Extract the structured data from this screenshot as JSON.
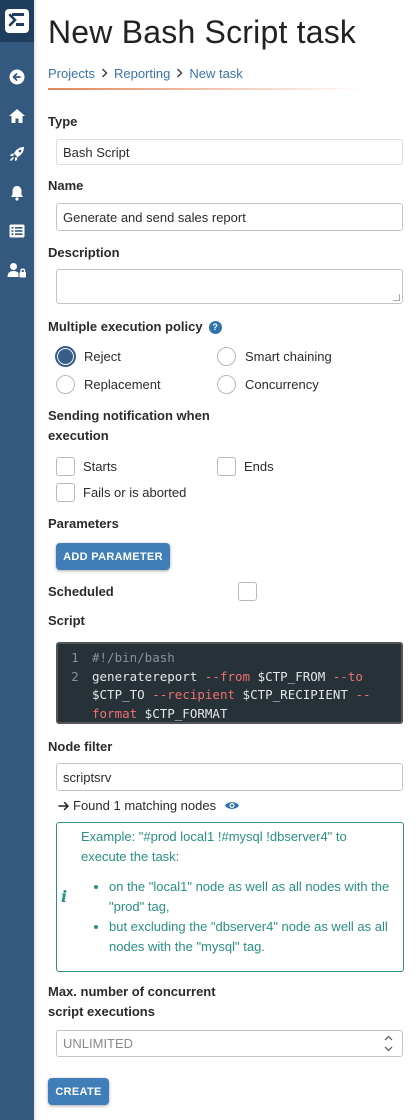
{
  "page": {
    "title": "New Bash Script task"
  },
  "breadcrumb": [
    {
      "label": "Projects"
    },
    {
      "label": "Reporting"
    },
    {
      "label": "New task"
    }
  ],
  "sidebar": {
    "logo_icon": "app-logo-icon",
    "items": [
      {
        "icon": "back-arrow-icon"
      },
      {
        "icon": "home-icon"
      },
      {
        "icon": "rocket-icon"
      },
      {
        "icon": "bell-icon"
      },
      {
        "icon": "list-icon"
      },
      {
        "icon": "user-lock-icon"
      }
    ]
  },
  "form": {
    "type": {
      "label": "Type",
      "value": "Bash Script"
    },
    "name": {
      "label": "Name",
      "value": "Generate and send sales report"
    },
    "description": {
      "label": "Description",
      "value": ""
    },
    "execution_policy": {
      "label": "Multiple execution policy",
      "help_glyph": "?",
      "options": [
        {
          "label": "Reject",
          "checked": true
        },
        {
          "label": "Smart chaining",
          "checked": false
        },
        {
          "label": "Replacement",
          "checked": false
        },
        {
          "label": "Concurrency",
          "checked": false
        }
      ]
    },
    "notification": {
      "label": "Sending notification when execution",
      "options": [
        {
          "label": "Starts",
          "checked": false
        },
        {
          "label": "Ends",
          "checked": false
        },
        {
          "label": "Fails or is aborted",
          "checked": false
        }
      ]
    },
    "parameters": {
      "label": "Parameters",
      "add_button": "ADD PARAMETER"
    },
    "scheduled": {
      "label": "Scheduled",
      "checked": false
    },
    "script": {
      "label": "Script",
      "line_numbers": [
        "1",
        "2"
      ],
      "line1": "#!/bin/bash",
      "line2_tokens": [
        {
          "text": "generatereport ",
          "kind": "cmd"
        },
        {
          "text": "--from",
          "kind": "flag"
        },
        {
          "text": " $CTP_FROM ",
          "kind": "var"
        },
        {
          "text": "--to",
          "kind": "flag"
        },
        {
          "text": " $CTP_TO ",
          "kind": "var"
        },
        {
          "text": "--recipient",
          "kind": "flag"
        },
        {
          "text": " $CTP_RECIPIENT ",
          "kind": "var"
        },
        {
          "text": "--format",
          "kind": "flag"
        },
        {
          "text": " $CTP_FORMAT",
          "kind": "var"
        }
      ]
    },
    "node_filter": {
      "label": "Node filter",
      "value": "scriptsrv",
      "matching_text": "Found 1 matching nodes",
      "matching_arrow_icon": "arrow-right-icon",
      "eye_icon": "eye-icon"
    },
    "example": {
      "intro": "Example: \"#prod local1 !#mysql !dbserver4\" to execute the task:",
      "bullets": [
        "on the \"local1\" node as well as all nodes with the \"prod\" tag,",
        "but excluding the \"dbserver4\" node as well as all nodes with the \"mysql\" tag."
      ],
      "icon": "info-icon",
      "icon_glyph": "i"
    },
    "max_concurrent": {
      "label": "Max. number of concurrent script executions",
      "placeholder": "UNLIMITED"
    },
    "create_button": "CREATE"
  },
  "colors": {
    "sidebar": "#33597e",
    "accent": "#3f7eb8",
    "link": "#3a73ad",
    "info_teal": "#2a8f84",
    "breadcrumb_underline": "#e2855a"
  }
}
